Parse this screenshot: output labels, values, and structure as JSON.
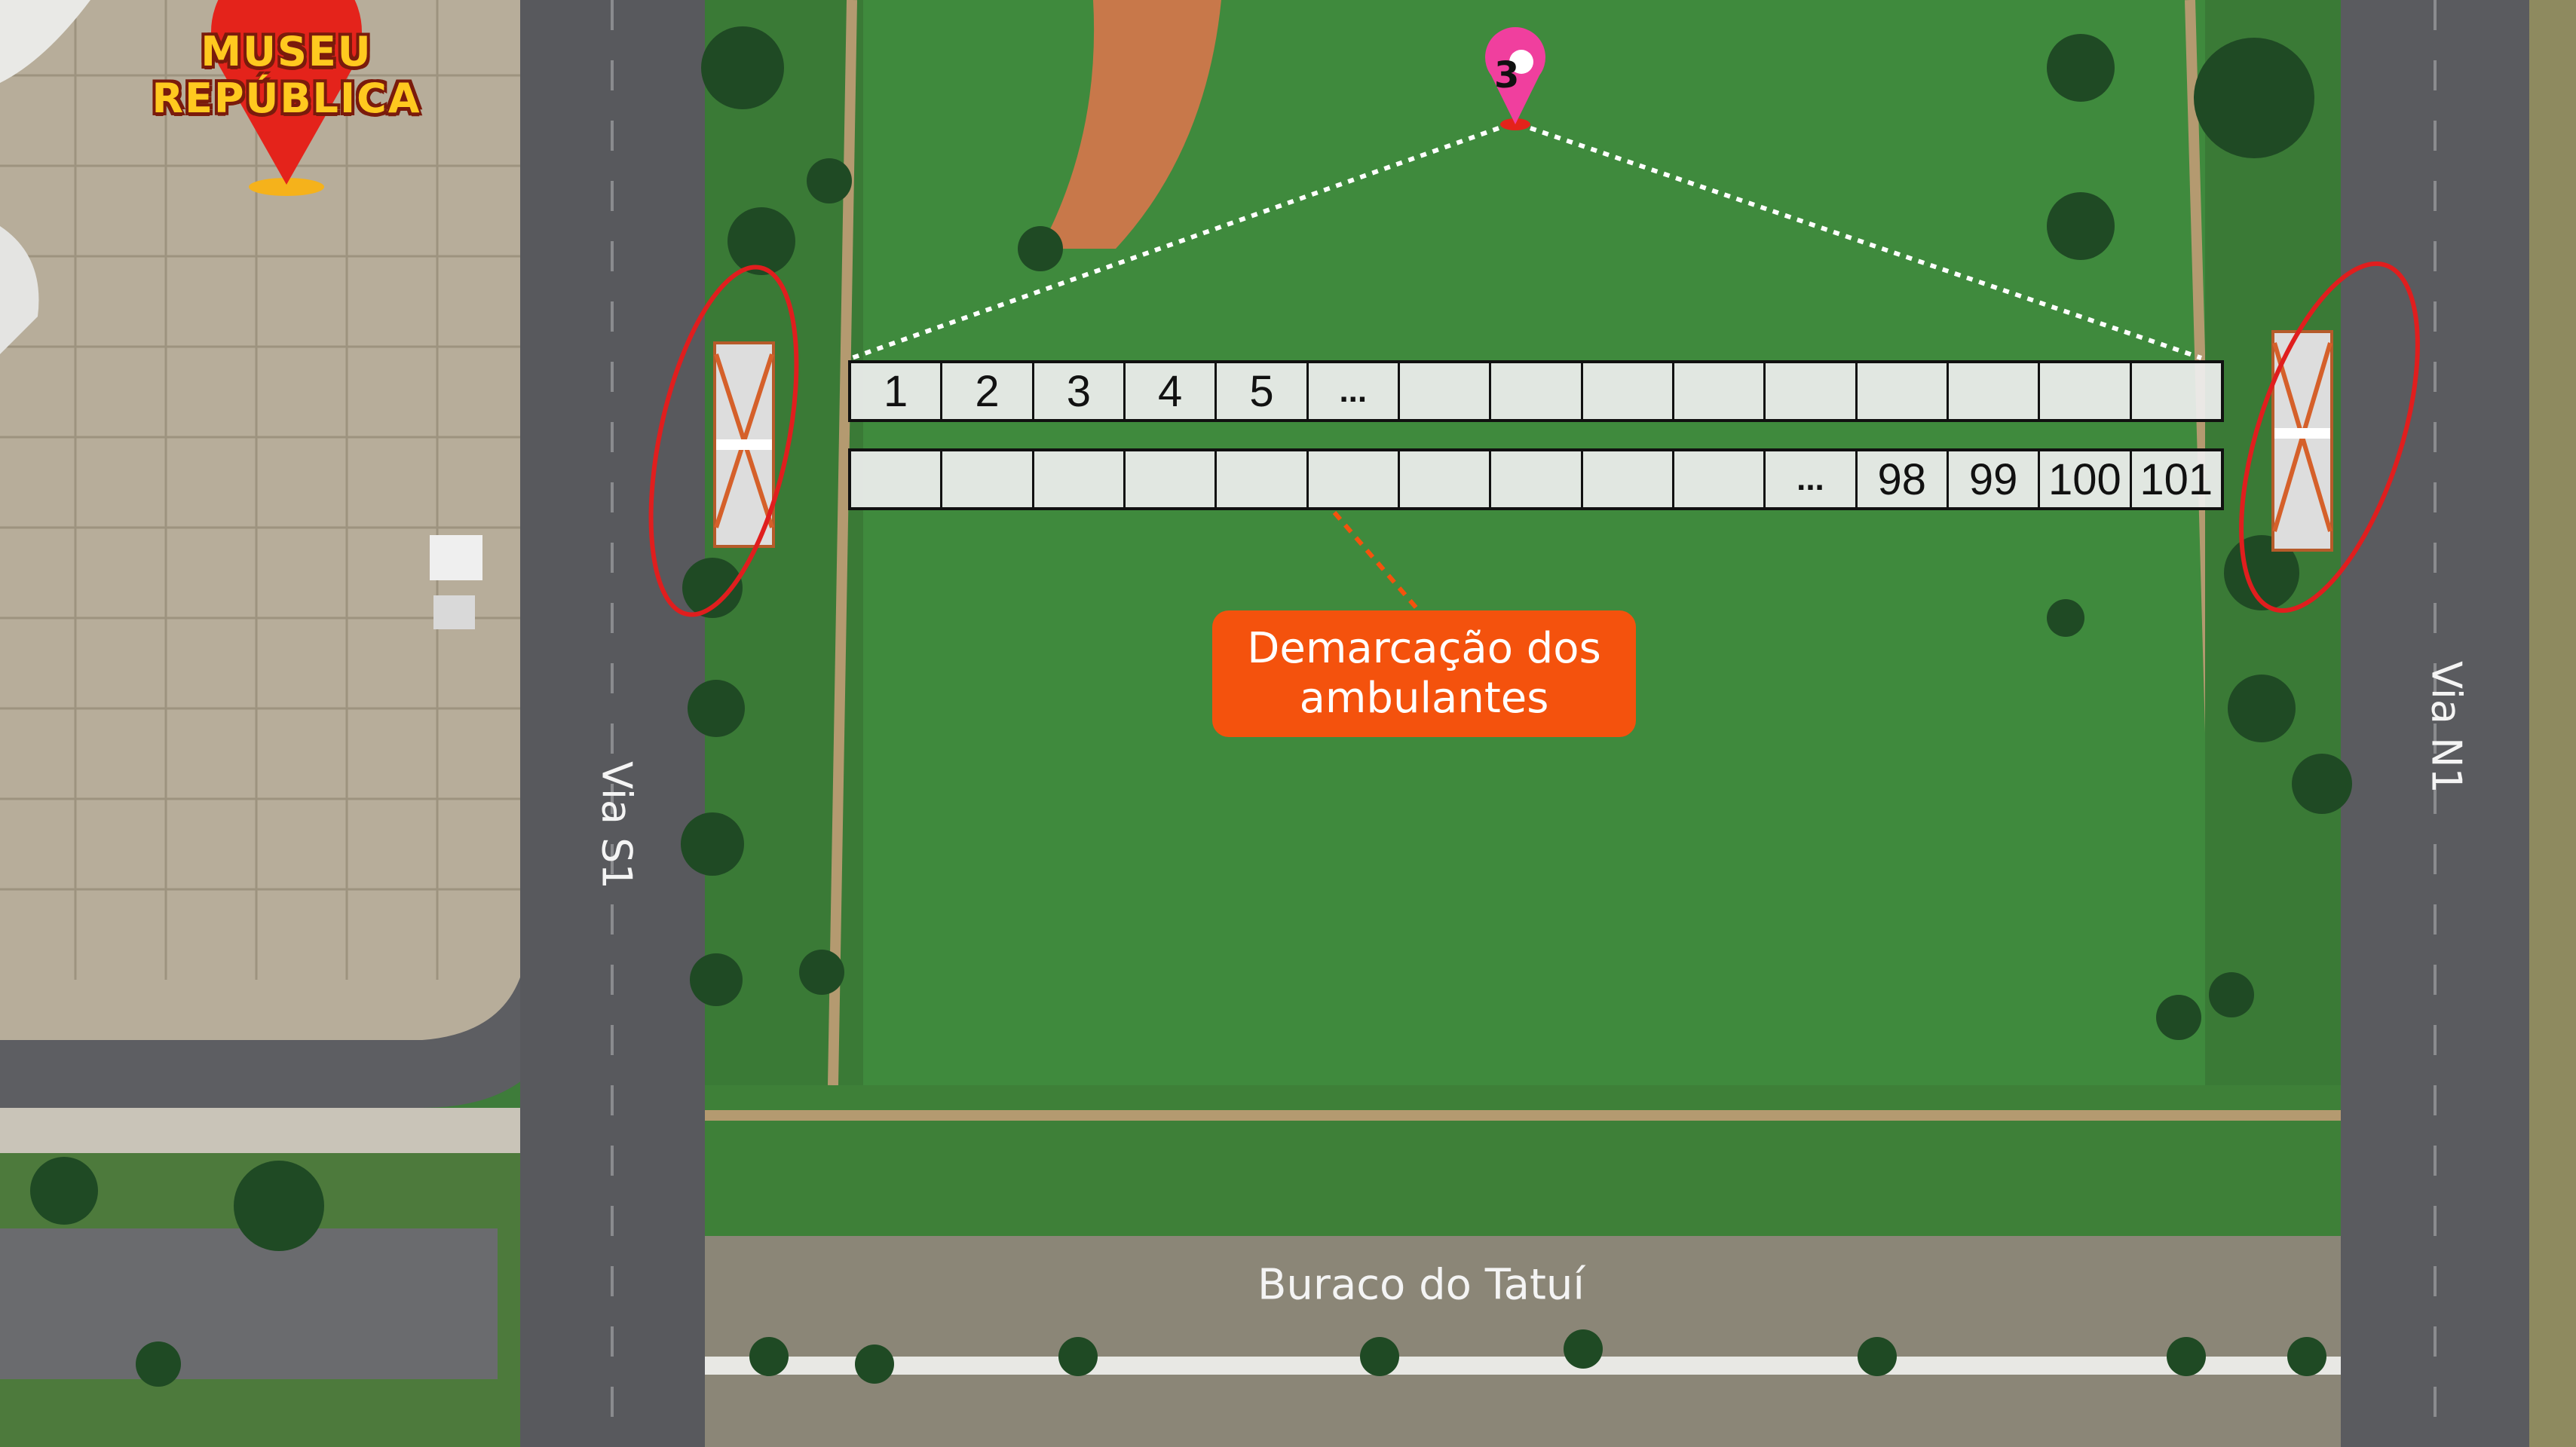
{
  "landmark": {
    "line1": "MUSEU",
    "line2": "REPÚBLICA",
    "pin_color": "#e4231b",
    "text_color": "#ffc91f"
  },
  "marker": {
    "number": "3",
    "color": "#f03f9e"
  },
  "roads": {
    "via_s1": "Via S1",
    "via_n1": "Via N1",
    "bottom": "Buraco do Tatuí"
  },
  "callout": {
    "line1": "Demarcação dos",
    "line2": "ambulantes",
    "color": "#f4520d"
  },
  "grid": {
    "top_row": [
      "1",
      "2",
      "3",
      "4",
      "5",
      "...",
      "",
      "",
      "",
      "",
      "",
      "",
      "",
      "",
      ""
    ],
    "bottom_row": [
      "",
      "",
      "",
      "",
      "",
      "",
      "",
      "",
      "",
      "",
      "...",
      "98",
      "99",
      "100",
      "101"
    ]
  },
  "highlight_color": "#e01e1e",
  "icons": [
    "location-pin-icon",
    "numbered-pin-icon",
    "barrier-icon"
  ]
}
